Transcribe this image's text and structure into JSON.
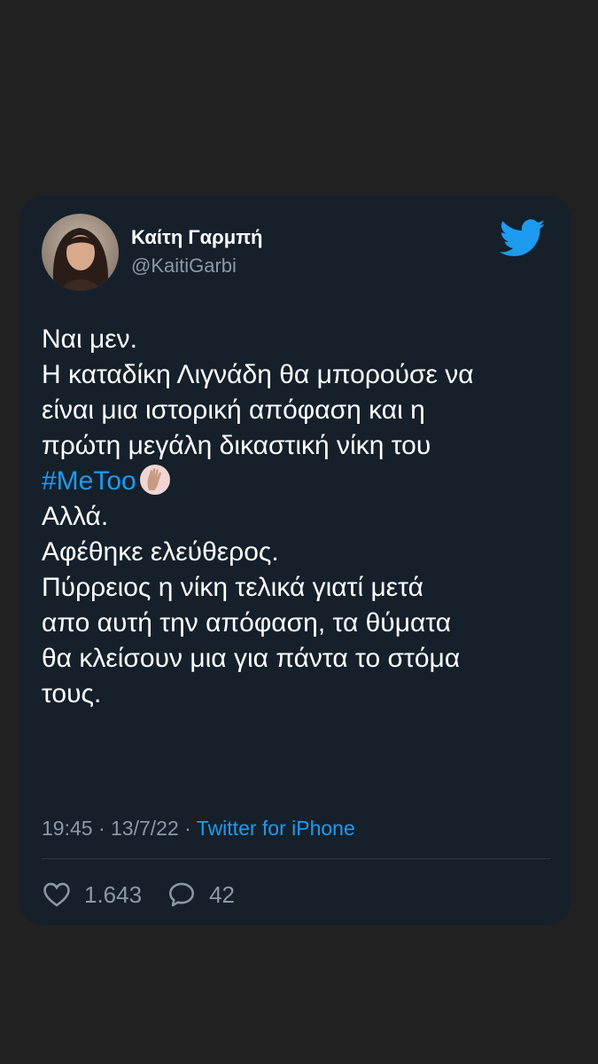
{
  "tweet": {
    "author": {
      "display_name": "Καίτη Γαρμπή",
      "handle": "@KaitiGarbi"
    },
    "brand_icon": "twitter-bird-icon",
    "body": {
      "line1": "Ναι μεν.",
      "line2": "Η καταδίκη Λιγνάδη θα μπορούσε να",
      "line3": "είναι μια ιστορική απόφαση και η",
      "line4": "πρώτη μεγάλη δικαστική νίκη του",
      "hashtag": "#MeToo",
      "hashtag_emoji": "raised-hand-emoji",
      "line6": "Αλλά.",
      "line7": "Αφέθηκε ελεύθερος.",
      "line8": "Πύρρειος η νίκη τελικά γιατί μετά",
      "line9": "απο αυτή την απόφαση, τα  θύματα",
      "line10": "θα κλείσουν μια για πάντα το στόμα",
      "line11": "τους."
    },
    "meta": {
      "time": "19:45",
      "date": "13/7/22",
      "separator": " · ",
      "source": "Twitter for iPhone"
    },
    "stats": {
      "likes": "1.643",
      "replies": "42"
    },
    "colors": {
      "card_background": "#15202b",
      "page_background": "#212121",
      "accent": "#1d9bf0",
      "secondary_text": "#8b98a5"
    }
  }
}
